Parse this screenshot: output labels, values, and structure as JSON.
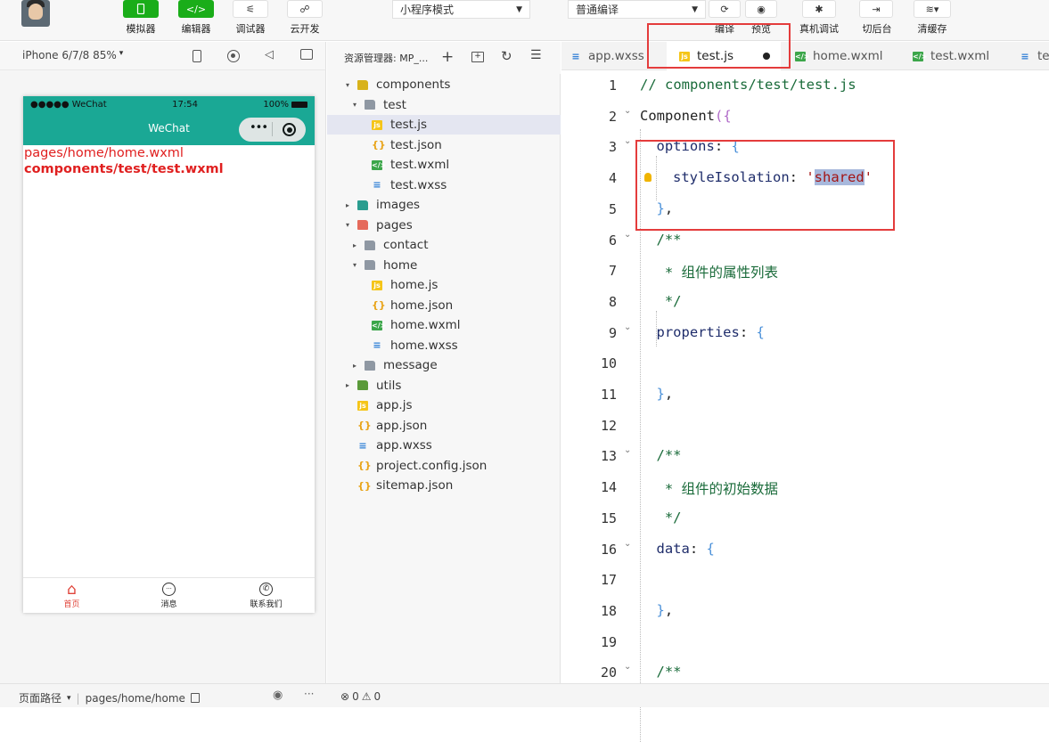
{
  "toolbar": {
    "simulator_label": "模拟器",
    "editor_label": "编辑器",
    "debugger_label": "调试器",
    "cloud_label": "云开发",
    "mode_select": "小程序模式",
    "compile_select": "普通编译",
    "compile_label": "编译",
    "preview_label": "预览",
    "remote_debug_label": "真机调试",
    "background_label": "切后台",
    "clear_cache_label": "清缓存"
  },
  "simulator": {
    "device_select": "iPhone 6/7/8 85%",
    "status_carrier": "●●●●● WeChat",
    "status_time": "17:54",
    "status_battery": "100%",
    "nav_title": "WeChat",
    "page_text_1": "pages/home/home.wxml",
    "page_text_2": "components/test/test.wxml",
    "tab_home": "首页",
    "tab_message": "消息",
    "tab_contact": "联系我们",
    "colors": {
      "nav_bg": "#1aa895",
      "page_text": "#e02020",
      "tab_active": "#e0443a"
    }
  },
  "explorer": {
    "title": "资源管理器: MP_...",
    "tree": [
      {
        "label": "components",
        "indent": 0,
        "kind": "folder-open",
        "icon": "folder-components-icon"
      },
      {
        "label": "test",
        "indent": 1,
        "kind": "folder-open",
        "icon": "folder-icon"
      },
      {
        "label": "test.js",
        "indent": 2,
        "kind": "js",
        "icon": "js-file-icon",
        "selected": true
      },
      {
        "label": "test.json",
        "indent": 2,
        "kind": "json",
        "icon": "json-file-icon"
      },
      {
        "label": "test.wxml",
        "indent": 2,
        "kind": "wxml",
        "icon": "wxml-file-icon"
      },
      {
        "label": "test.wxss",
        "indent": 2,
        "kind": "wxss",
        "icon": "wxss-file-icon"
      },
      {
        "label": "images",
        "indent": 0,
        "kind": "folder-closed",
        "icon": "folder-images-icon"
      },
      {
        "label": "pages",
        "indent": 0,
        "kind": "folder-open",
        "icon": "folder-pages-icon"
      },
      {
        "label": "contact",
        "indent": 1,
        "kind": "folder-closed",
        "icon": "folder-icon"
      },
      {
        "label": "home",
        "indent": 1,
        "kind": "folder-open",
        "icon": "folder-icon"
      },
      {
        "label": "home.js",
        "indent": 2,
        "kind": "js",
        "icon": "js-file-icon"
      },
      {
        "label": "home.json",
        "indent": 2,
        "kind": "json",
        "icon": "json-file-icon"
      },
      {
        "label": "home.wxml",
        "indent": 2,
        "kind": "wxml",
        "icon": "wxml-file-icon"
      },
      {
        "label": "home.wxss",
        "indent": 2,
        "kind": "wxss",
        "icon": "wxss-file-icon"
      },
      {
        "label": "message",
        "indent": 1,
        "kind": "folder-closed",
        "icon": "folder-icon"
      },
      {
        "label": "utils",
        "indent": 0,
        "kind": "folder-closed",
        "icon": "folder-utils-icon"
      },
      {
        "label": "app.js",
        "indent": 0,
        "kind": "js",
        "icon": "js-file-icon"
      },
      {
        "label": "app.json",
        "indent": 0,
        "kind": "json",
        "icon": "json-file-icon"
      },
      {
        "label": "app.wxss",
        "indent": 0,
        "kind": "wxss",
        "icon": "wxss-file-icon"
      },
      {
        "label": "project.config.json",
        "indent": 0,
        "kind": "json",
        "icon": "json-file-icon"
      },
      {
        "label": "sitemap.json",
        "indent": 0,
        "kind": "json",
        "icon": "json-file-icon"
      }
    ]
  },
  "tabs": [
    {
      "label": "app.wxss",
      "kind": "wxss",
      "active": false
    },
    {
      "label": "test.js",
      "kind": "js",
      "active": true,
      "modified": true
    },
    {
      "label": "home.wxml",
      "kind": "wxml",
      "active": false
    },
    {
      "label": "test.wxml",
      "kind": "wxml",
      "active": false
    },
    {
      "label": "te",
      "kind": "wxss",
      "active": false
    }
  ],
  "editor": {
    "lines": [
      {
        "n": "1",
        "segments": [
          {
            "t": "// components/test/test.js",
            "c": "comment"
          }
        ]
      },
      {
        "n": "2",
        "fold": true,
        "segments": [
          {
            "t": "Component",
            "c": "plain"
          },
          {
            "t": "({",
            "c": "brace"
          }
        ]
      },
      {
        "n": "3",
        "fold": true,
        "indent": 1,
        "segments": [
          {
            "t": "options",
            "c": "key"
          },
          {
            "t": ": ",
            "c": "plain"
          },
          {
            "t": "{",
            "c": "brace2"
          }
        ]
      },
      {
        "n": "4",
        "indent": 2,
        "bulb": true,
        "segments": [
          {
            "t": "styleIsolation",
            "c": "key"
          },
          {
            "t": ": ",
            "c": "plain"
          },
          {
            "t": "'",
            "c": "str"
          },
          {
            "t": "shared",
            "c": "strsel"
          },
          {
            "t": "'",
            "c": "str"
          }
        ]
      },
      {
        "n": "5",
        "indent": 1,
        "segments": [
          {
            "t": "}",
            "c": "brace2"
          },
          {
            "t": ",",
            "c": "plain"
          }
        ]
      },
      {
        "n": "6",
        "fold": true,
        "indent": 1,
        "segments": [
          {
            "t": "/**",
            "c": "comment"
          }
        ]
      },
      {
        "n": "7",
        "indent": 1,
        "segments": [
          {
            "t": " * 组件的属性列表",
            "c": "comment"
          }
        ]
      },
      {
        "n": "8",
        "indent": 1,
        "segments": [
          {
            "t": " */",
            "c": "comment"
          }
        ]
      },
      {
        "n": "9",
        "fold": true,
        "indent": 1,
        "segments": [
          {
            "t": "properties",
            "c": "key"
          },
          {
            "t": ": ",
            "c": "plain"
          },
          {
            "t": "{",
            "c": "brace2"
          }
        ]
      },
      {
        "n": "10",
        "segments": []
      },
      {
        "n": "11",
        "indent": 1,
        "segments": [
          {
            "t": "}",
            "c": "brace2"
          },
          {
            "t": ",",
            "c": "plain"
          }
        ]
      },
      {
        "n": "12",
        "segments": []
      },
      {
        "n": "13",
        "fold": true,
        "indent": 1,
        "segments": [
          {
            "t": "/**",
            "c": "comment"
          }
        ]
      },
      {
        "n": "14",
        "indent": 1,
        "segments": [
          {
            "t": " * 组件的初始数据",
            "c": "comment"
          }
        ]
      },
      {
        "n": "15",
        "indent": 1,
        "segments": [
          {
            "t": " */",
            "c": "comment"
          }
        ]
      },
      {
        "n": "16",
        "fold": true,
        "indent": 1,
        "segments": [
          {
            "t": "data",
            "c": "key"
          },
          {
            "t": ": ",
            "c": "plain"
          },
          {
            "t": "{",
            "c": "brace2"
          }
        ]
      },
      {
        "n": "17",
        "segments": []
      },
      {
        "n": "18",
        "indent": 1,
        "segments": [
          {
            "t": "}",
            "c": "brace2"
          },
          {
            "t": ",",
            "c": "plain"
          }
        ]
      },
      {
        "n": "19",
        "segments": []
      },
      {
        "n": "20",
        "fold": true,
        "indent": 1,
        "segments": [
          {
            "t": "/**",
            "c": "comment"
          }
        ]
      }
    ],
    "colors": {
      "comment": "#1a6b3a",
      "key": "#1f2d6b",
      "plain": "#222222",
      "brace": "#b06ac8",
      "brace2": "#4a90d9",
      "str": "#a31515",
      "selection": "#a7b8dc"
    }
  },
  "status": {
    "path_label": "页面路径",
    "path_value": "pages/home/home",
    "errors": "0",
    "warnings": "0"
  }
}
